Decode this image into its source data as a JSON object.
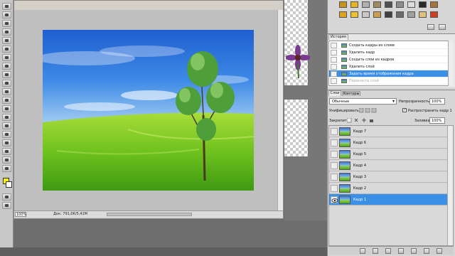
{
  "document": {
    "zoom": "100%",
    "info": "Док: 791,0K/5,41M"
  },
  "history": {
    "tab": "История",
    "items": [
      {
        "label": "Создать кадры из слоев",
        "state": "normal"
      },
      {
        "label": "Удалить кадр",
        "state": "normal"
      },
      {
        "label": "Создать слои из кадров",
        "state": "normal"
      },
      {
        "label": "Удалить слой",
        "state": "normal"
      },
      {
        "label": "Задать время отображения кадра",
        "state": "selected"
      },
      {
        "label": "Перенести слой",
        "state": "dimmed"
      }
    ]
  },
  "layers_panel": {
    "tab_layers": "Слои",
    "tab_paths": "Контуры",
    "blend_mode": "Обычные",
    "opacity_label": "Непрозрачность:",
    "opacity_value": "100%",
    "unify_label": "Унифицировать:",
    "propagate_label": "Распространить кадр 1",
    "propagate_checked": "✓",
    "lock_label": "Закрепить:",
    "fill_label": "Заливка:",
    "fill_value": "100%",
    "layers": [
      {
        "name": "Кадр 7",
        "selected": false
      },
      {
        "name": "Кадр 6",
        "selected": false
      },
      {
        "name": "Кадр 5",
        "selected": false
      },
      {
        "name": "Кадр 4",
        "selected": false
      },
      {
        "name": "Кадр 3",
        "selected": false
      },
      {
        "name": "Кадр 2",
        "selected": false
      },
      {
        "name": "Кадр 1",
        "selected": true
      }
    ]
  },
  "colors": {
    "foreground": "#f6f200",
    "background": "#ffffff",
    "selection": "#3b8fe5"
  }
}
